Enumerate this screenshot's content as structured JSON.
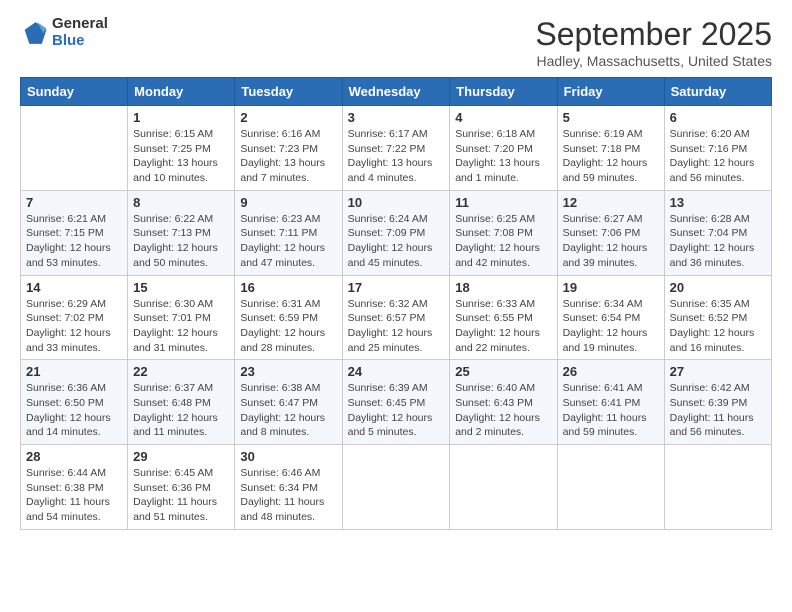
{
  "logo": {
    "general": "General",
    "blue": "Blue"
  },
  "title": "September 2025",
  "location": "Hadley, Massachusetts, United States",
  "days_of_week": [
    "Sunday",
    "Monday",
    "Tuesday",
    "Wednesday",
    "Thursday",
    "Friday",
    "Saturday"
  ],
  "weeks": [
    [
      {
        "num": "",
        "sunrise": "",
        "sunset": "",
        "daylight": ""
      },
      {
        "num": "1",
        "sunrise": "Sunrise: 6:15 AM",
        "sunset": "Sunset: 7:25 PM",
        "daylight": "Daylight: 13 hours and 10 minutes."
      },
      {
        "num": "2",
        "sunrise": "Sunrise: 6:16 AM",
        "sunset": "Sunset: 7:23 PM",
        "daylight": "Daylight: 13 hours and 7 minutes."
      },
      {
        "num": "3",
        "sunrise": "Sunrise: 6:17 AM",
        "sunset": "Sunset: 7:22 PM",
        "daylight": "Daylight: 13 hours and 4 minutes."
      },
      {
        "num": "4",
        "sunrise": "Sunrise: 6:18 AM",
        "sunset": "Sunset: 7:20 PM",
        "daylight": "Daylight: 13 hours and 1 minute."
      },
      {
        "num": "5",
        "sunrise": "Sunrise: 6:19 AM",
        "sunset": "Sunset: 7:18 PM",
        "daylight": "Daylight: 12 hours and 59 minutes."
      },
      {
        "num": "6",
        "sunrise": "Sunrise: 6:20 AM",
        "sunset": "Sunset: 7:16 PM",
        "daylight": "Daylight: 12 hours and 56 minutes."
      }
    ],
    [
      {
        "num": "7",
        "sunrise": "Sunrise: 6:21 AM",
        "sunset": "Sunset: 7:15 PM",
        "daylight": "Daylight: 12 hours and 53 minutes."
      },
      {
        "num": "8",
        "sunrise": "Sunrise: 6:22 AM",
        "sunset": "Sunset: 7:13 PM",
        "daylight": "Daylight: 12 hours and 50 minutes."
      },
      {
        "num": "9",
        "sunrise": "Sunrise: 6:23 AM",
        "sunset": "Sunset: 7:11 PM",
        "daylight": "Daylight: 12 hours and 47 minutes."
      },
      {
        "num": "10",
        "sunrise": "Sunrise: 6:24 AM",
        "sunset": "Sunset: 7:09 PM",
        "daylight": "Daylight: 12 hours and 45 minutes."
      },
      {
        "num": "11",
        "sunrise": "Sunrise: 6:25 AM",
        "sunset": "Sunset: 7:08 PM",
        "daylight": "Daylight: 12 hours and 42 minutes."
      },
      {
        "num": "12",
        "sunrise": "Sunrise: 6:27 AM",
        "sunset": "Sunset: 7:06 PM",
        "daylight": "Daylight: 12 hours and 39 minutes."
      },
      {
        "num": "13",
        "sunrise": "Sunrise: 6:28 AM",
        "sunset": "Sunset: 7:04 PM",
        "daylight": "Daylight: 12 hours and 36 minutes."
      }
    ],
    [
      {
        "num": "14",
        "sunrise": "Sunrise: 6:29 AM",
        "sunset": "Sunset: 7:02 PM",
        "daylight": "Daylight: 12 hours and 33 minutes."
      },
      {
        "num": "15",
        "sunrise": "Sunrise: 6:30 AM",
        "sunset": "Sunset: 7:01 PM",
        "daylight": "Daylight: 12 hours and 31 minutes."
      },
      {
        "num": "16",
        "sunrise": "Sunrise: 6:31 AM",
        "sunset": "Sunset: 6:59 PM",
        "daylight": "Daylight: 12 hours and 28 minutes."
      },
      {
        "num": "17",
        "sunrise": "Sunrise: 6:32 AM",
        "sunset": "Sunset: 6:57 PM",
        "daylight": "Daylight: 12 hours and 25 minutes."
      },
      {
        "num": "18",
        "sunrise": "Sunrise: 6:33 AM",
        "sunset": "Sunset: 6:55 PM",
        "daylight": "Daylight: 12 hours and 22 minutes."
      },
      {
        "num": "19",
        "sunrise": "Sunrise: 6:34 AM",
        "sunset": "Sunset: 6:54 PM",
        "daylight": "Daylight: 12 hours and 19 minutes."
      },
      {
        "num": "20",
        "sunrise": "Sunrise: 6:35 AM",
        "sunset": "Sunset: 6:52 PM",
        "daylight": "Daylight: 12 hours and 16 minutes."
      }
    ],
    [
      {
        "num": "21",
        "sunrise": "Sunrise: 6:36 AM",
        "sunset": "Sunset: 6:50 PM",
        "daylight": "Daylight: 12 hours and 14 minutes."
      },
      {
        "num": "22",
        "sunrise": "Sunrise: 6:37 AM",
        "sunset": "Sunset: 6:48 PM",
        "daylight": "Daylight: 12 hours and 11 minutes."
      },
      {
        "num": "23",
        "sunrise": "Sunrise: 6:38 AM",
        "sunset": "Sunset: 6:47 PM",
        "daylight": "Daylight: 12 hours and 8 minutes."
      },
      {
        "num": "24",
        "sunrise": "Sunrise: 6:39 AM",
        "sunset": "Sunset: 6:45 PM",
        "daylight": "Daylight: 12 hours and 5 minutes."
      },
      {
        "num": "25",
        "sunrise": "Sunrise: 6:40 AM",
        "sunset": "Sunset: 6:43 PM",
        "daylight": "Daylight: 12 hours and 2 minutes."
      },
      {
        "num": "26",
        "sunrise": "Sunrise: 6:41 AM",
        "sunset": "Sunset: 6:41 PM",
        "daylight": "Daylight: 11 hours and 59 minutes."
      },
      {
        "num": "27",
        "sunrise": "Sunrise: 6:42 AM",
        "sunset": "Sunset: 6:39 PM",
        "daylight": "Daylight: 11 hours and 56 minutes."
      }
    ],
    [
      {
        "num": "28",
        "sunrise": "Sunrise: 6:44 AM",
        "sunset": "Sunset: 6:38 PM",
        "daylight": "Daylight: 11 hours and 54 minutes."
      },
      {
        "num": "29",
        "sunrise": "Sunrise: 6:45 AM",
        "sunset": "Sunset: 6:36 PM",
        "daylight": "Daylight: 11 hours and 51 minutes."
      },
      {
        "num": "30",
        "sunrise": "Sunrise: 6:46 AM",
        "sunset": "Sunset: 6:34 PM",
        "daylight": "Daylight: 11 hours and 48 minutes."
      },
      {
        "num": "",
        "sunrise": "",
        "sunset": "",
        "daylight": ""
      },
      {
        "num": "",
        "sunrise": "",
        "sunset": "",
        "daylight": ""
      },
      {
        "num": "",
        "sunrise": "",
        "sunset": "",
        "daylight": ""
      },
      {
        "num": "",
        "sunrise": "",
        "sunset": "",
        "daylight": ""
      }
    ]
  ]
}
